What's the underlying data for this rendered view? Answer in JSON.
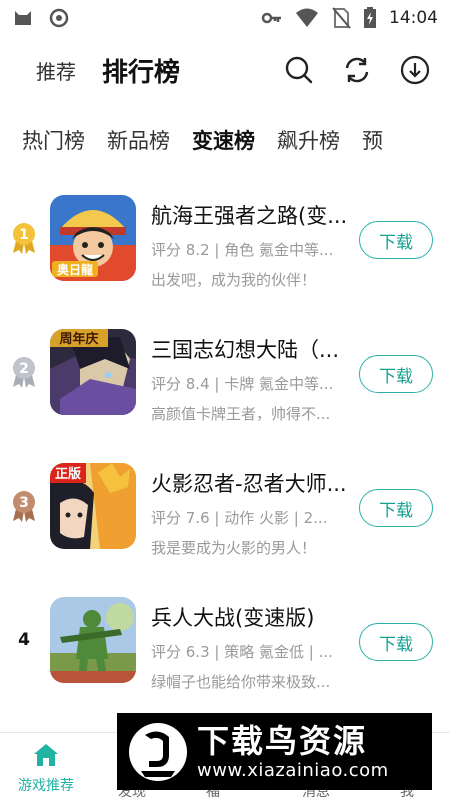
{
  "status_bar": {
    "time": "14:04",
    "icons": [
      "cat-notification-icon",
      "circle-notification-icon",
      "key-icon",
      "wifi-icon",
      "no-sim-icon",
      "battery-icon"
    ]
  },
  "header": {
    "tab_recommend": "推荐",
    "tab_rank": "排行榜",
    "icons": [
      "search-icon",
      "refresh-icon",
      "download-icon"
    ]
  },
  "subtabs": [
    {
      "label": "热门榜",
      "active": false
    },
    {
      "label": "新品榜",
      "active": false
    },
    {
      "label": "变速榜",
      "active": true
    },
    {
      "label": "飙升榜",
      "active": false
    },
    {
      "label": "预",
      "active": false
    }
  ],
  "apps": [
    {
      "rank": "1",
      "title": "航海王强者之路(变...",
      "meta": "评分  8.2 | 角色  氪金中等...",
      "desc": "出发吧，成为我的伙伴！",
      "button": "下载",
      "icon_badge": "奥日龍"
    },
    {
      "rank": "2",
      "title": "三国志幻想大陆（...",
      "meta": "评分  8.4 | 卡牌  氪金中等...",
      "desc": "高颜值卡牌王者，帅得不...",
      "button": "下载",
      "icon_badge": "周年庆"
    },
    {
      "rank": "3",
      "title": "火影忍者-忍者大师...",
      "meta": "评分  7.6 | 动作  火影  | 2...",
      "desc": "我是要成为火影的男人！",
      "button": "下载",
      "icon_badge": "正版"
    },
    {
      "rank": "4",
      "title": "兵人大战(变速版)",
      "meta": "评分  6.3 | 策略  氪金低  | ...",
      "desc": "绿帽子也能给你带来极致...",
      "button": "下载",
      "icon_badge": ""
    }
  ],
  "bottom_nav": {
    "home_label": "游戏推荐",
    "item2_partial": "发现",
    "item3_partial": "福",
    "item4_partial": "消息",
    "item5_partial": "我"
  },
  "watermark": {
    "title": "下载鸟资源",
    "url": "www.xiazainiao.com"
  },
  "colors": {
    "accent": "#2bb3a8",
    "medal_gold": "#f0c040",
    "medal_silver": "#b7bcc4",
    "medal_bronze": "#c08a6a"
  }
}
